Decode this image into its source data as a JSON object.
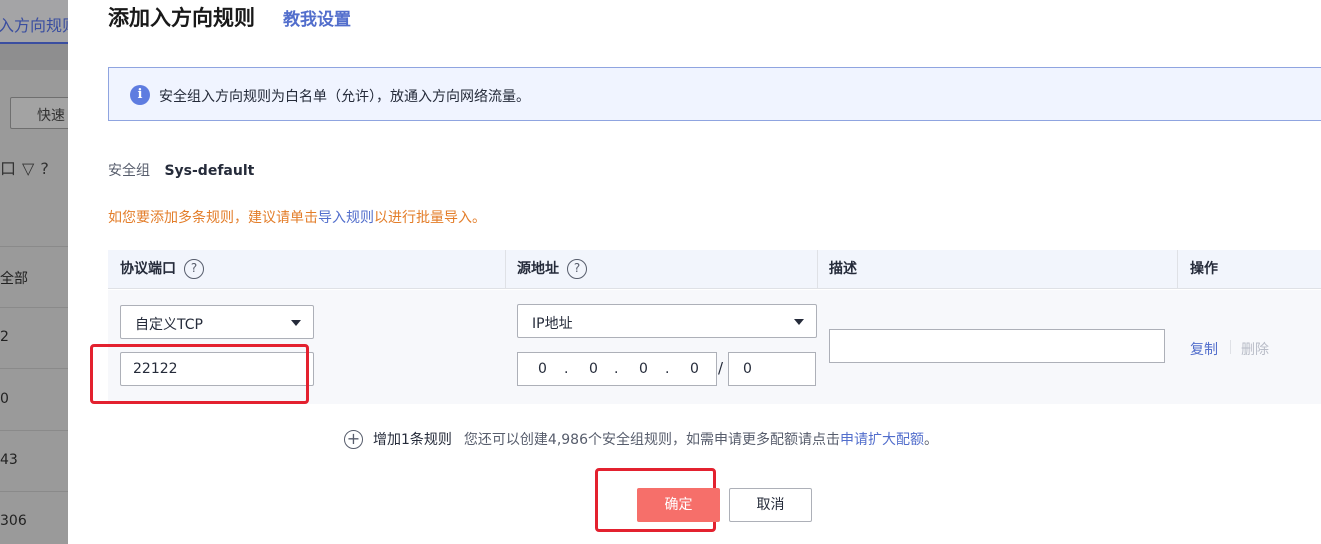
{
  "background": {
    "tab_label": "入方向规则",
    "quick_button": "快速",
    "filter_icons": [
      "口",
      "▽",
      "?"
    ],
    "cells": [
      "全部",
      "2",
      "0",
      "43",
      "306"
    ]
  },
  "drawer": {
    "title": "添加入方向规则",
    "help_link": "教我设置",
    "info_text": "安全组入方向规则为白名单（允许），放通入方向网络流量。",
    "security_group": {
      "label": "安全组",
      "value": "Sys-default"
    },
    "batch_tip": {
      "prefix": "如您要添加多条规则，建议请单击",
      "link": "导入规则",
      "suffix": "以进行批量导入。"
    },
    "table": {
      "headers": {
        "protocol_port": "协议端口",
        "source": "源地址",
        "description": "描述",
        "action": "操作"
      },
      "row": {
        "protocol": "自定义TCP",
        "port": "22122",
        "source_type": "IP地址",
        "ip_octets": [
          "0",
          "0",
          "0",
          "0"
        ],
        "ip_dot": ".",
        "slash": "/",
        "mask": "0",
        "description": "",
        "copy_label": "复制",
        "delete_label": "删除"
      }
    },
    "add_rule": {
      "icon": "+",
      "label": "增加1条规则",
      "tip_prefix": "您还可以创建4,986个安全组规则，如需申请更多配额请点击",
      "tip_link": "申请扩大配额",
      "tip_suffix": "。"
    },
    "buttons": {
      "ok": "确定",
      "cancel": "取消"
    }
  },
  "colors": {
    "primary": "#526ecc",
    "warning": "#e37d29",
    "ok_button": "#f66f6a",
    "annotation_red": "#e3212f"
  }
}
